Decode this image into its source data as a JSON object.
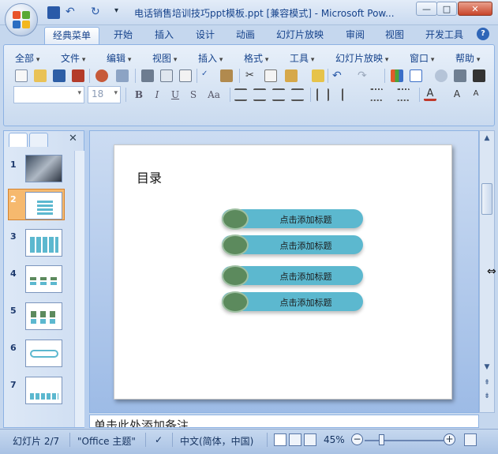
{
  "window": {
    "title": "电话销售培训技巧ppt模板.ppt [兼容模式] - Microsoft Pow...",
    "minimize": "—",
    "maximize": "□",
    "close": "✕"
  },
  "ribbon_tabs": [
    "经典菜单",
    "开始",
    "插入",
    "设计",
    "动画",
    "幻灯片放映",
    "审阅",
    "视图",
    "开发工具"
  ],
  "help_label": "?",
  "classic_menu": [
    "全部",
    "文件",
    "编辑",
    "视图",
    "插入",
    "格式",
    "工具",
    "幻灯片放映",
    "窗口",
    "帮助"
  ],
  "font_combo": {
    "name": "",
    "size": "18"
  },
  "format_buttons": [
    "B",
    "I",
    "U",
    "S",
    "Aa"
  ],
  "slide_panel": {
    "thumbs": [
      {
        "num": "1"
      },
      {
        "num": "2"
      },
      {
        "num": "3"
      },
      {
        "num": "4"
      },
      {
        "num": "5"
      },
      {
        "num": "6"
      },
      {
        "num": "7"
      }
    ],
    "selected": "2",
    "close_label": "✕"
  },
  "slide": {
    "title": "目录",
    "items": [
      "点击添加标题",
      "点击添加标题",
      "点击添加标题",
      "点击添加标题"
    ]
  },
  "notes_placeholder": "单击此处添加备注",
  "status": {
    "slide_counter": "幻灯片 2/7",
    "theme": "\"Office 主题\"",
    "language": "中文(简体，中国)",
    "zoom": "45%",
    "zoom_minus": "−",
    "zoom_plus": "+"
  },
  "colors": {
    "item_bar": "#5cb8cf",
    "item_bullet": "#5c8a5d",
    "selected_thumb": "#f6b96e",
    "ribbon_bg": "#dbe6f4"
  }
}
